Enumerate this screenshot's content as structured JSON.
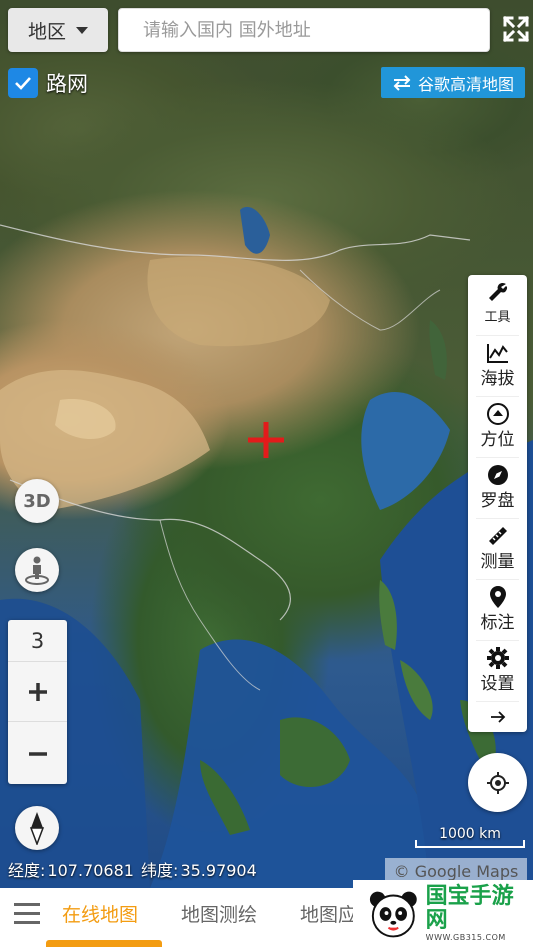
{
  "topbar": {
    "region_label": "地区",
    "search_placeholder": "请输入国内 国外地址"
  },
  "roadnet": {
    "label": "路网",
    "checked": true
  },
  "map_switch": {
    "label": "谷歌高清地图"
  },
  "tools": [
    {
      "label": "工具",
      "icon": "wrench-icon"
    },
    {
      "label": "海拔",
      "icon": "elevation-chart-icon"
    },
    {
      "label": "方位",
      "icon": "direction-icon"
    },
    {
      "label": "罗盘",
      "icon": "compass-icon"
    },
    {
      "label": "测量",
      "icon": "ruler-icon"
    },
    {
      "label": "标注",
      "icon": "pin-icon"
    },
    {
      "label": "设置",
      "icon": "gear-icon"
    }
  ],
  "view_3d": {
    "label": "3D"
  },
  "zoom": {
    "level": "3",
    "in_label": "+",
    "out_label": "−"
  },
  "scale": {
    "label": "1000 km"
  },
  "coords": {
    "lon_label": "经度:",
    "lon_value": "107.70681",
    "lat_label": "纬度:",
    "lat_value": "35.97904"
  },
  "attribution": "© Google Maps",
  "bottom_nav": {
    "tabs": [
      {
        "label": "在线地图",
        "active": true
      },
      {
        "label": "地图测绘",
        "active": false
      },
      {
        "label": "地图应",
        "active": false
      }
    ]
  },
  "watermark": {
    "main": "国宝手游网",
    "url": "WWW.GB315.COM"
  },
  "colors": {
    "accent": "#f39c12",
    "primary_blue": "#2196d9",
    "crosshair": "#e31b1b"
  }
}
